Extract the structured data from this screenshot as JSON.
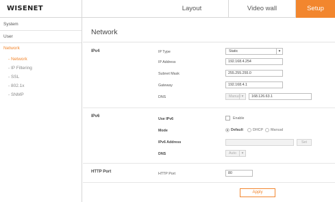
{
  "app": {
    "logo": "WISENET"
  },
  "tabs": [
    {
      "label": "Layout"
    },
    {
      "label": "Video wall"
    },
    {
      "label": "Setup"
    }
  ],
  "sidebar": {
    "items": [
      {
        "label": "System"
      },
      {
        "label": "User"
      },
      {
        "label": "Network"
      }
    ],
    "subitems": [
      {
        "label": "- Network"
      },
      {
        "label": "- IP Filtering"
      },
      {
        "label": "- SSL"
      },
      {
        "label": "- 802.1x"
      },
      {
        "label": "- SNMP"
      }
    ]
  },
  "page": {
    "title": "Network"
  },
  "ipv4": {
    "section": "IPv4",
    "ip_type_label": "IP Type",
    "ip_type_value": "Static",
    "ip_address_label": "IP Address",
    "ip_address_value": "192.168.4.254",
    "subnet_label": "Subnet Mask",
    "subnet_value": "255.255.255.0",
    "gateway_label": "Gateway",
    "gateway_value": "192.168.4.1",
    "dns_label": "DNS",
    "dns_mode": "Manual",
    "dns_value": "168.126.63.1"
  },
  "ipv6": {
    "section": "IPv6",
    "use_label": "Use IPv6",
    "enable_label": "Enable",
    "mode_label": "Mode",
    "mode_options": [
      "Default",
      "DHCP",
      "Manual"
    ],
    "address_label": "IPv6 Address",
    "set_label": "Set",
    "dns_label": "DNS",
    "dns_mode": "Auto"
  },
  "http": {
    "section": "HTTP Port",
    "port_label": "HTTP Port",
    "port_value": "80"
  },
  "actions": {
    "apply": "Apply"
  },
  "colors": {
    "accent": "#f2862e"
  }
}
